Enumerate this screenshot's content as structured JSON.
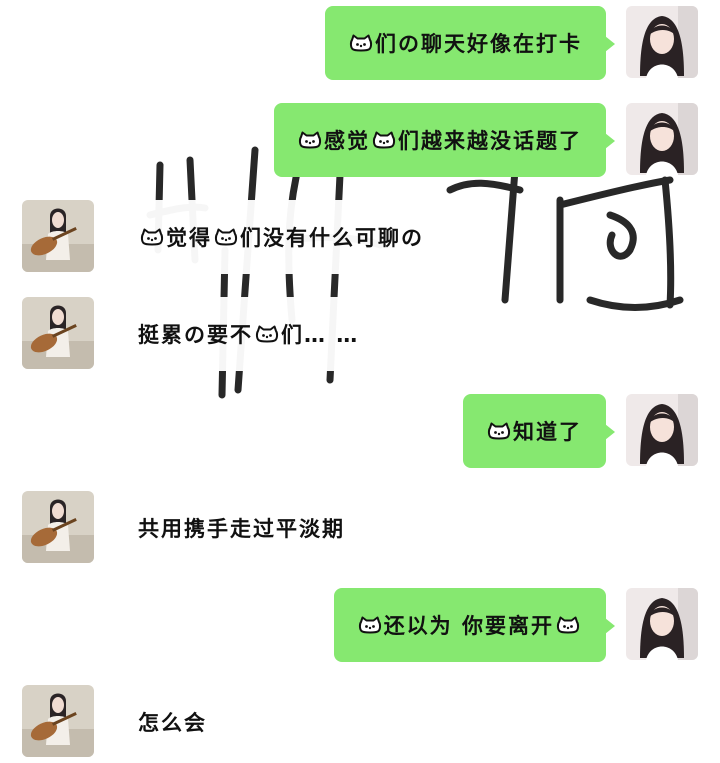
{
  "icons": {
    "cat": "cat-face-icon"
  },
  "colors": {
    "sent_bubble": "#86e870",
    "recv_bubble": "#ffffff"
  },
  "messages": [
    {
      "side": "right",
      "segments": [
        {
          "icon": "cat"
        },
        {
          "text": "们の聊天好像在打卡"
        }
      ]
    },
    {
      "side": "right",
      "segments": [
        {
          "icon": "cat"
        },
        {
          "text": "感觉"
        },
        {
          "icon": "cat"
        },
        {
          "text": "们越来越没话题了"
        }
      ]
    },
    {
      "side": "left",
      "segments": [
        {
          "icon": "cat"
        },
        {
          "text": "觉得"
        },
        {
          "icon": "cat"
        },
        {
          "text": "们没有什么可聊の"
        }
      ]
    },
    {
      "side": "left",
      "segments": [
        {
          "text": "挺累の要不"
        },
        {
          "icon": "cat"
        },
        {
          "text": "们… …"
        }
      ]
    },
    {
      "side": "right",
      "segments": [
        {
          "icon": "cat"
        },
        {
          "text": "知道了"
        }
      ]
    },
    {
      "side": "left",
      "segments": [
        {
          "text": "共用携手走过平淡期"
        }
      ]
    },
    {
      "side": "right",
      "segments": [
        {
          "icon": "cat"
        },
        {
          "text": "还以为 你要离开"
        },
        {
          "icon": "cat"
        }
      ]
    },
    {
      "side": "left",
      "segments": [
        {
          "text": "怎么会"
        }
      ]
    }
  ]
}
